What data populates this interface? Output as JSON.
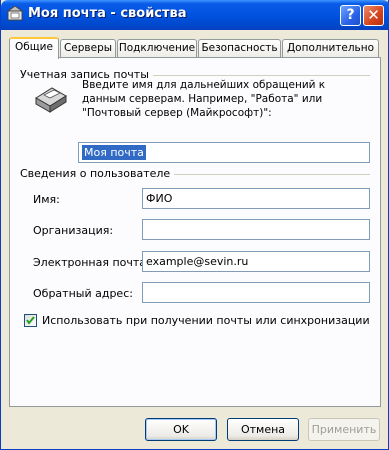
{
  "window": {
    "title": "Моя почта - свойства"
  },
  "titlebar_buttons": {
    "help": "?",
    "close": "✕"
  },
  "tabs": [
    {
      "label": "Общие",
      "active": true
    },
    {
      "label": "Серверы"
    },
    {
      "label": "Подключение"
    },
    {
      "label": "Безопасность"
    },
    {
      "label": "Дополнительно"
    }
  ],
  "account": {
    "group_title": "Учетная запись почты",
    "description": "Введите имя для дальнейших обращений к данным серверам. Например, \"Работа\" или \"Почтовый сервер (Майкрософт)\":",
    "name_value": "Моя почта"
  },
  "user": {
    "group_title": "Сведения о пользователе",
    "fields": [
      {
        "label": "Имя:",
        "value": "ФИО"
      },
      {
        "label": "Организация:",
        "value": ""
      },
      {
        "label": "Электронная почта:",
        "value": "example@sevin.ru"
      },
      {
        "label": "Обратный адрес:",
        "value": ""
      }
    ]
  },
  "sync_checkbox": {
    "label": "Использовать при получении почты или синхронизации",
    "checked": true
  },
  "buttons": {
    "ok": "OK",
    "cancel": "Отмена",
    "apply": "Применить"
  }
}
